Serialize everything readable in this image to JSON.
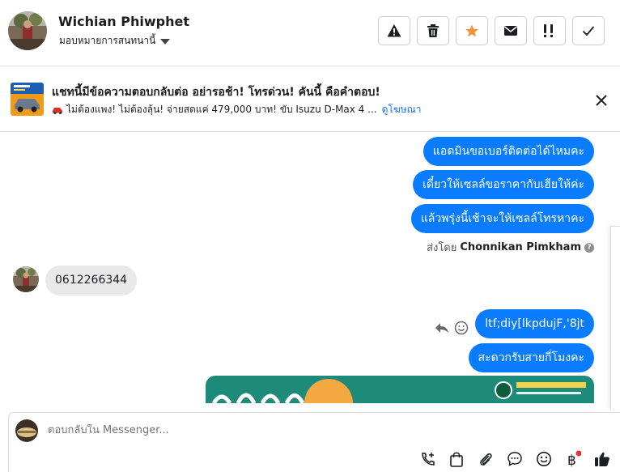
{
  "header": {
    "contact_name": "Wichian Phiwphet",
    "assign_label": "มอบหมายการสนทนานี้",
    "actions": [
      "warning-icon",
      "trash-icon",
      "star-icon",
      "envelope-icon",
      "exclamation-icon",
      "check-icon"
    ],
    "accent_star": "#f7923a"
  },
  "ad": {
    "title": "แชทนี้มีข้อความตอบกลับต่อ อย่ารอช้า! โทรด่วน! คันนี้ คือคำตอบ!",
    "subtitle": "ไม่ต้องแพง! ไม่ต้องลุ้น! จ่ายสดแค่ 479,000 บาท! ขับ Isuzu D-Max 4 ...",
    "link": "ดูโฆษณา"
  },
  "messages": {
    "out1": "แอดมินขอเบอร์ติดต่อได้ไหมคะ",
    "out2": "เดี๋ยวให้เซลล์ขอราคากับเฮียให้ค่ะ",
    "out3": "แล้วพรุ่งนี้เช้าจะให้เซลล์โทรหาคะ",
    "sent_by_prefix": "ส่งโดย",
    "sent_by_name": "Chonnikan Pimkham",
    "in1": "0612266344",
    "out4": "ltf;diy[lkpdujF,'8jt",
    "out5": "สะดวกรับสายกี่โมงคะ",
    "bubble_color": "#0a7cff"
  },
  "composer": {
    "placeholder": "ตอบกลับใน Messenger...",
    "tools": [
      "phone-plus-icon",
      "shopping-bag-icon",
      "paperclip-icon",
      "chat-bubble-icon",
      "smiley-icon",
      "baht-icon",
      "thumbs-up-icon"
    ]
  }
}
